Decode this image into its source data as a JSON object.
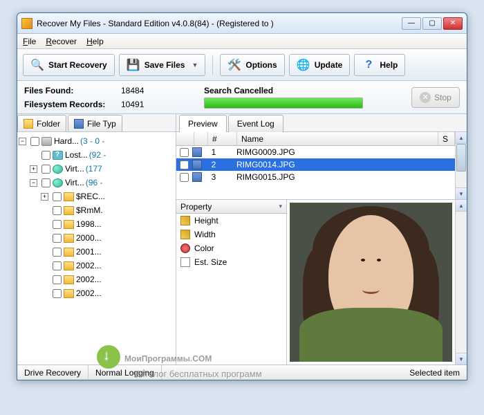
{
  "titlebar": {
    "title": "Recover My Files - Standard Edition v4.0.8(84)  -  (Registered to )"
  },
  "menu": {
    "file": "File",
    "recover": "Recover",
    "help": "Help"
  },
  "toolbar": {
    "start": "Start Recovery",
    "save": "Save Files",
    "options": "Options",
    "update": "Update",
    "help": "Help"
  },
  "stats": {
    "files_found_label": "Files Found:",
    "files_found": "18484",
    "fs_records_label": "Filesystem Records:",
    "fs_records": "10491",
    "search_msg": "Search Cancelled",
    "stop": "Stop"
  },
  "left_tabs": {
    "folder": "Folder",
    "filetype": "File Typ"
  },
  "tree": [
    {
      "ind": 0,
      "tg": "−",
      "ic": "hd",
      "lbl": "Hard...",
      "stat": "(3 - 0 -"
    },
    {
      "ind": 1,
      "tg": "",
      "ic": "q",
      "lbl": "Lost...",
      "stat": "(92 -"
    },
    {
      "ind": 1,
      "tg": "+",
      "ic": "gl",
      "lbl": "Virt...",
      "stat": "(177"
    },
    {
      "ind": 1,
      "tg": "−",
      "ic": "gl",
      "lbl": "Virt...",
      "stat": "(96 -"
    },
    {
      "ind": 2,
      "tg": "+",
      "ic": "f",
      "lbl": "$REC...",
      "stat": ""
    },
    {
      "ind": 2,
      "tg": "",
      "ic": "f",
      "lbl": "$RmM.",
      "stat": ""
    },
    {
      "ind": 2,
      "tg": "",
      "ic": "f",
      "lbl": "1998...",
      "stat": ""
    },
    {
      "ind": 2,
      "tg": "",
      "ic": "f",
      "lbl": "2000...",
      "stat": ""
    },
    {
      "ind": 2,
      "tg": "",
      "ic": "f",
      "lbl": "2001...",
      "stat": ""
    },
    {
      "ind": 2,
      "tg": "",
      "ic": "f",
      "lbl": "2002...",
      "stat": ""
    },
    {
      "ind": 2,
      "tg": "",
      "ic": "f",
      "lbl": "2002...",
      "stat": ""
    },
    {
      "ind": 2,
      "tg": "",
      "ic": "f",
      "lbl": "2002...",
      "stat": ""
    }
  ],
  "right_tabs": {
    "preview": "Preview",
    "event_log": "Event Log"
  },
  "file_list": {
    "cols": {
      "num": "#",
      "name": "Name",
      "s": "S"
    },
    "rows": [
      {
        "n": "1",
        "name": "RIMG0009.JPG",
        "sel": false
      },
      {
        "n": "2",
        "name": "RIMG0014.JPG",
        "sel": true
      },
      {
        "n": "3",
        "name": "RIMG0015.JPG",
        "sel": false
      }
    ]
  },
  "props": {
    "header": "Property",
    "items": [
      "Height",
      "Width",
      "Color",
      "Est. Size"
    ]
  },
  "statusbar": {
    "mode": "Drive Recovery",
    "log": "Normal Logging",
    "sel": "Selected item"
  },
  "watermark": {
    "main": "МоиПрограммы.COM",
    "sub": "Каталог бесплатных программ"
  }
}
